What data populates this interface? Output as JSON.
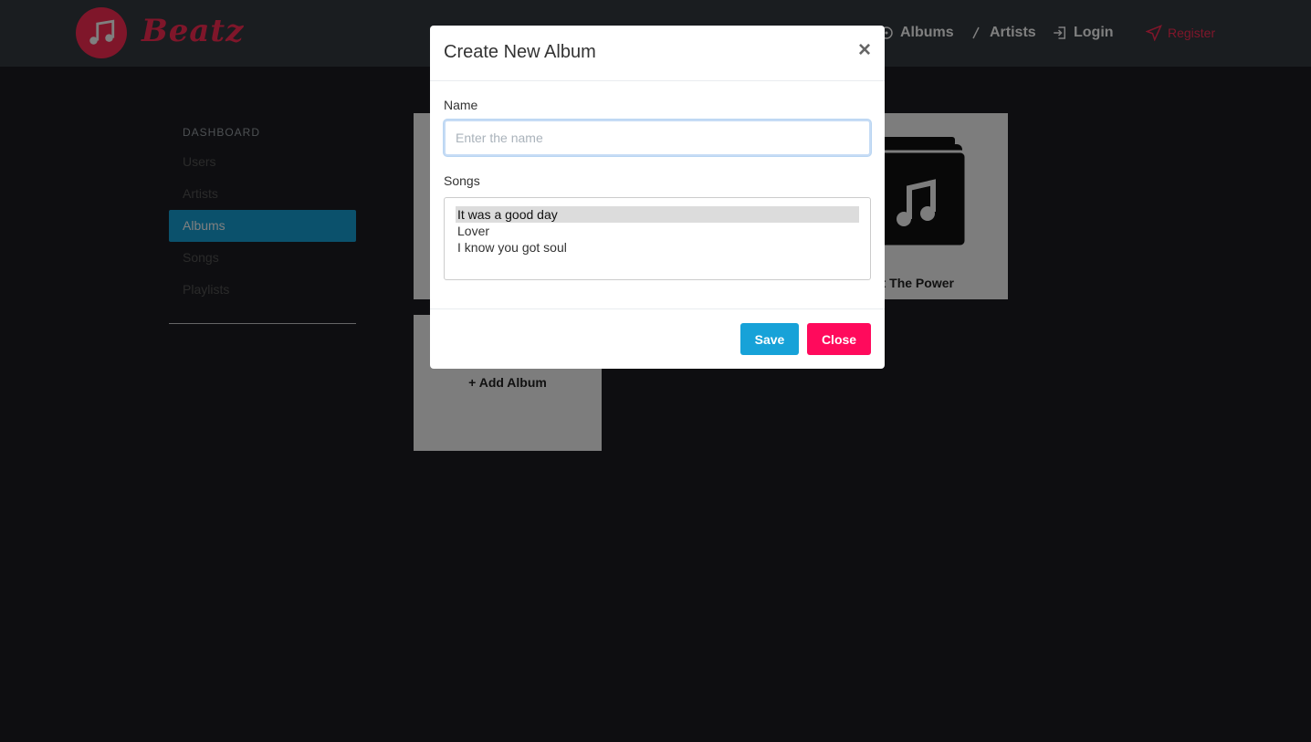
{
  "header": {
    "brand": "Beatz",
    "nav": {
      "albums": "Albums",
      "artists": "Artists",
      "login": "Login",
      "register": "Register"
    }
  },
  "sidebar": {
    "heading": "DASHBOARD",
    "items": [
      {
        "label": "Users"
      },
      {
        "label": "Artists"
      },
      {
        "label": "Albums",
        "active": true
      },
      {
        "label": "Songs"
      },
      {
        "label": "Playlists"
      }
    ]
  },
  "albums": {
    "cards": [
      {
        "title": ""
      },
      {
        "title": "ht The Power"
      }
    ],
    "add_label": "+ Add Album"
  },
  "modal": {
    "title": "Create New Album",
    "close_symbol": "×",
    "name_label": "Name",
    "name_value": "",
    "name_placeholder": "Enter the name",
    "songs_label": "Songs",
    "songs": [
      {
        "label": "It was a good day",
        "selected": true
      },
      {
        "label": "Lover",
        "selected": false
      },
      {
        "label": "I know you got soul",
        "selected": false
      }
    ],
    "save_label": "Save",
    "close_label": "Close"
  },
  "colors": {
    "accent": "#17a2d8",
    "brand": "#ff2d55",
    "close_button": "#ff0a5c",
    "background": "#1c1d22"
  }
}
